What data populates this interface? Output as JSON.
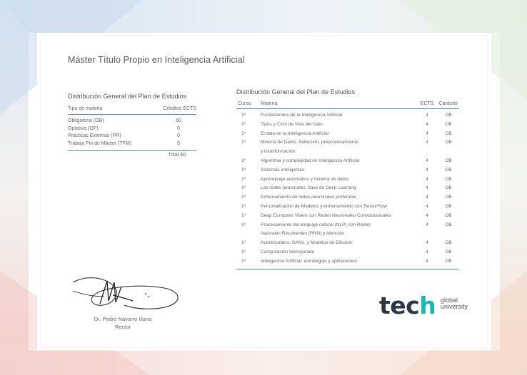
{
  "title": "Máster Título Propio en Inteligencia Artificial",
  "summary": {
    "heading": "Distribución General del Plan de Estudios",
    "col_type": "Tipo de materia",
    "col_credits": "Créditos ECTS",
    "rows": [
      {
        "type": "Obligatoria (OB)",
        "credits": "60"
      },
      {
        "type": "Optativa (OP)",
        "credits": "0"
      },
      {
        "type": "Prácticas Externas (PR)",
        "credits": "0"
      },
      {
        "type": "Trabajo Fin de Máster (TFM)",
        "credits": "0"
      }
    ],
    "total": "Total 60"
  },
  "courses": {
    "heading": "Distribución General del Plan de Estudios",
    "col_curso": "Curso",
    "col_materia": "Materia",
    "col_ects": "ECTS",
    "col_caracter": "Carácter",
    "rows": [
      {
        "curso": "1º",
        "materia": "Fundamentos de la Inteligencia Artificial",
        "ects": "4",
        "caracter": "OB"
      },
      {
        "curso": "1º",
        "materia": "Tipos y Ciclo de Vida del Dato",
        "ects": "4",
        "caracter": "OB"
      },
      {
        "curso": "1º",
        "materia": "El dato en la Inteligencia Artificial",
        "ects": "4",
        "caracter": "OB"
      },
      {
        "curso": "1º",
        "materia": "Minería de Datos. Selección, preprocesamiento",
        "ects": "4",
        "caracter": "OB"
      },
      {
        "curso": "",
        "materia": "y transformación",
        "ects": "",
        "caracter": ""
      },
      {
        "curso": "1º",
        "materia": "Algoritmia y complejidad en Inteligencia Artificial",
        "ects": "4",
        "caracter": "OB"
      },
      {
        "curso": "1º",
        "materia": "Sistemas inteligentes",
        "ects": "4",
        "caracter": "OB"
      },
      {
        "curso": "1º",
        "materia": "Aprendizaje automático y minería de datos",
        "ects": "4",
        "caracter": "OB"
      },
      {
        "curso": "1º",
        "materia": "Las redes neuronales, base de Deep Learning",
        "ects": "4",
        "caracter": "OB"
      },
      {
        "curso": "1º",
        "materia": "Entrenamiento de redes neuronales profundas",
        "ects": "4",
        "caracter": "OB"
      },
      {
        "curso": "1º",
        "materia": "Personalización de Modelos y entrenamiento con TensorFlow",
        "ects": "4",
        "caracter": "OB"
      },
      {
        "curso": "1º",
        "materia": "Deep Computer Vision con Redes Neuronales Convolucionales",
        "ects": "4",
        "caracter": "OB"
      },
      {
        "curso": "1º",
        "materia": "Procesamiento del lenguaje natural (NLP) con Redes",
        "ects": "4",
        "caracter": "OB"
      },
      {
        "curso": "",
        "materia": "Naturales Recurrentes (RNN) y Atención",
        "ects": "",
        "caracter": ""
      },
      {
        "curso": "1º",
        "materia": "Autoencoders, GANs, y Modelos de Difusión",
        "ects": "4",
        "caracter": "OB"
      },
      {
        "curso": "1º",
        "materia": "Computación bioinspirada",
        "ects": "4",
        "caracter": "OB"
      },
      {
        "curso": "1º",
        "materia": "Inteligencia Artificial: estrategias y aplicaciones",
        "ects": "4",
        "caracter": "OB"
      }
    ]
  },
  "signer": {
    "name": "Dr. Pedro Navarro Illana",
    "role": "Rector"
  },
  "logo": {
    "mark_main": "tec",
    "mark_accent": "h",
    "sub_line1": "global",
    "sub_line2": "university"
  },
  "colors": {
    "rule": "#5b86b8",
    "logo_dark": "#2a3844",
    "logo_accent": "#16b9b3"
  }
}
